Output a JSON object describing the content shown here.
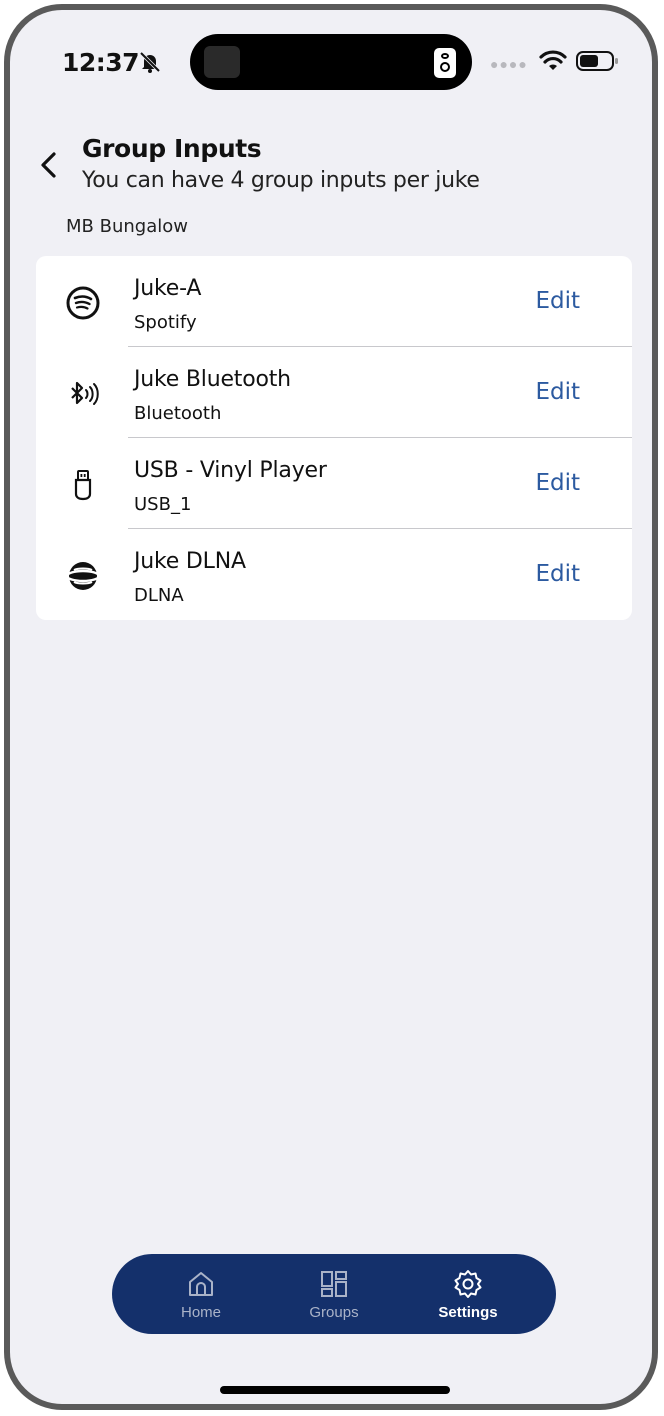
{
  "status_bar": {
    "time": "12:37",
    "icons": [
      "bell-slash-icon",
      "speaker-icon",
      "wifi-icon",
      "battery-icon"
    ]
  },
  "header": {
    "title": "Group Inputs",
    "subtitle": "You can have 4 group inputs per juke",
    "back_icon": "chevron-left-icon"
  },
  "section_label": "MB Bungalow",
  "inputs": [
    {
      "name": "Juke-A",
      "type": "Spotify",
      "icon": "spotify-icon",
      "action": "Edit"
    },
    {
      "name": "Juke Bluetooth",
      "type": "Bluetooth",
      "icon": "bluetooth-icon",
      "action": "Edit"
    },
    {
      "name": "USB - Vinyl Player",
      "type": "USB_1",
      "icon": "usb-icon",
      "action": "Edit"
    },
    {
      "name": "Juke DLNA",
      "type": "DLNA",
      "icon": "dlna-icon",
      "action": "Edit"
    }
  ],
  "tabbar": {
    "tabs": [
      {
        "label": "Home",
        "icon": "home-icon",
        "active": false
      },
      {
        "label": "Groups",
        "icon": "grid-icon",
        "active": false
      },
      {
        "label": "Settings",
        "icon": "gear-icon",
        "active": true
      }
    ]
  },
  "colors": {
    "background": "#f0f0f5",
    "accent": "#2c5aa0",
    "tabbar": "#14306b"
  }
}
